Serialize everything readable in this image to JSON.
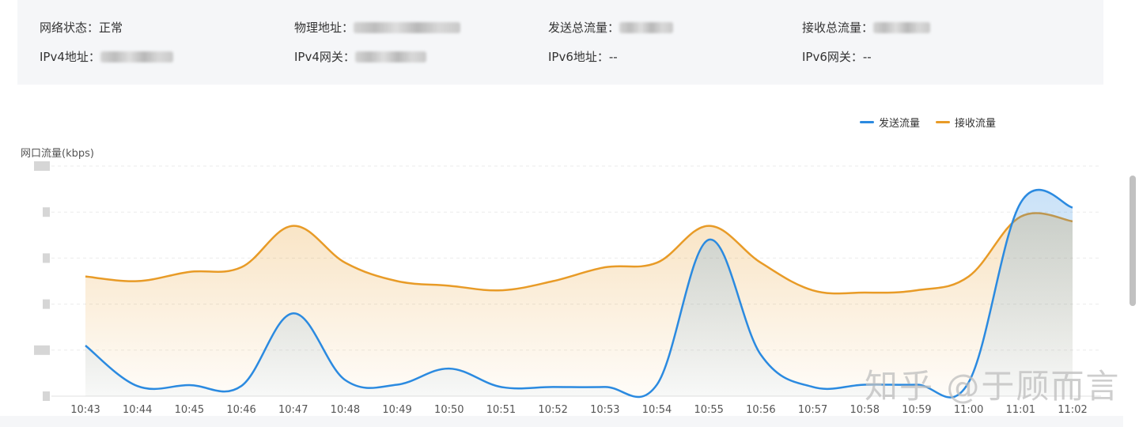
{
  "network_info": {
    "status": {
      "label": "网络状态：",
      "value": "正常"
    },
    "mac": {
      "label": "物理地址：",
      "value": ""
    },
    "tx_total": {
      "label": "发送总流量：",
      "value": ""
    },
    "rx_total": {
      "label": "接收总流量：",
      "value": ""
    },
    "ipv4": {
      "label": "IPv4地址：",
      "value": ""
    },
    "ipv4_gateway": {
      "label": "IPv4网关：",
      "value": ""
    },
    "ipv6": {
      "label": "IPv6地址：",
      "value": "--"
    },
    "ipv6_gateway": {
      "label": "IPv6网关：",
      "value": "--"
    }
  },
  "watermark": "知乎 @于顾而言",
  "chart_data": {
    "type": "area",
    "ylabel": "网口流量(kbps)",
    "legend_position": "top-right",
    "grid": true,
    "y_ticks_obscured": true,
    "ylim": [
      0,
      5
    ],
    "x": [
      "10:43",
      "10:44",
      "10:45",
      "10:46",
      "10:47",
      "10:48",
      "10:49",
      "10:50",
      "10:51",
      "10:52",
      "10:53",
      "10:54",
      "10:55",
      "10:56",
      "10:57",
      "10:58",
      "10:59",
      "11:00",
      "11:01",
      "11:02"
    ],
    "series": [
      {
        "name": "发送流量",
        "color": "#2b8ae0",
        "values": [
          1.1,
          0.22,
          0.24,
          0.22,
          1.8,
          0.35,
          0.25,
          0.6,
          0.2,
          0.2,
          0.2,
          0.25,
          3.4,
          0.9,
          0.2,
          0.25,
          0.25,
          0.3,
          4.2,
          4.1
        ]
      },
      {
        "name": "接收流量",
        "color": "#e89b27",
        "values": [
          2.6,
          2.5,
          2.7,
          2.8,
          3.7,
          2.9,
          2.5,
          2.4,
          2.3,
          2.5,
          2.8,
          2.9,
          3.7,
          2.9,
          2.3,
          2.25,
          2.3,
          2.6,
          3.9,
          3.8
        ]
      }
    ]
  }
}
